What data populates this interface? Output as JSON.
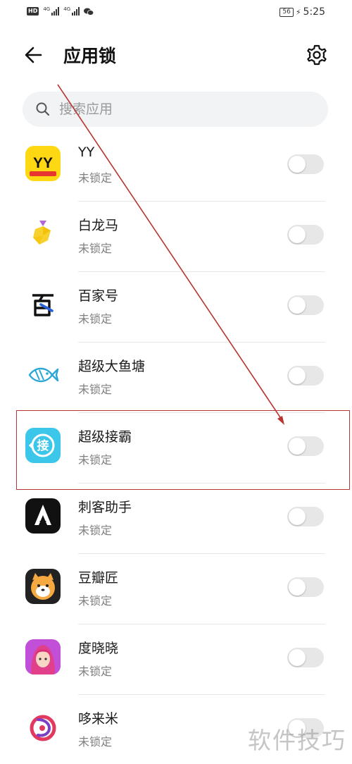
{
  "status_bar": {
    "hd_label": "HD",
    "net1": "4G",
    "net2": "4G",
    "battery": "56",
    "time": "5:25"
  },
  "header": {
    "title": "应用锁",
    "back_icon": "arrow-left-icon",
    "settings_icon": "gear-icon"
  },
  "search": {
    "placeholder": "搜索应用"
  },
  "apps": [
    {
      "name": "YY",
      "status": "未锁定",
      "icon": "yy-app-icon",
      "color": "#ffd814"
    },
    {
      "name": "白龙马",
      "status": "未锁定",
      "icon": "bailongma-app-icon",
      "color": "#ffd43b"
    },
    {
      "name": "百家号",
      "status": "未锁定",
      "icon": "baijiahao-app-icon",
      "color": "#1f3a8a"
    },
    {
      "name": "超级大鱼塘",
      "status": "未锁定",
      "icon": "fish-pond-app-icon",
      "color": "#29a7d8"
    },
    {
      "name": "超级接霸",
      "status": "未锁定",
      "icon": "jieba-app-icon",
      "color": "#3cc6ea"
    },
    {
      "name": "刺客助手",
      "status": "未锁定",
      "icon": "assassin-app-icon",
      "color": "#111111"
    },
    {
      "name": "豆瓣匠",
      "status": "未锁定",
      "icon": "doubanjiang-app-icon",
      "color": "#f1a33c"
    },
    {
      "name": "度晓晓",
      "status": "未锁定",
      "icon": "duxiaoxiao-app-icon",
      "color": "#c04fd6"
    },
    {
      "name": "哆来米",
      "status": "未锁定",
      "icon": "duolaimi-app-icon",
      "color": "#e23a5f"
    }
  ],
  "watermark": "软件技巧",
  "colors": {
    "annotation_red": "#b23a3a",
    "toggle_off": "#e7e7e7",
    "search_bg": "#f1f3f5"
  }
}
